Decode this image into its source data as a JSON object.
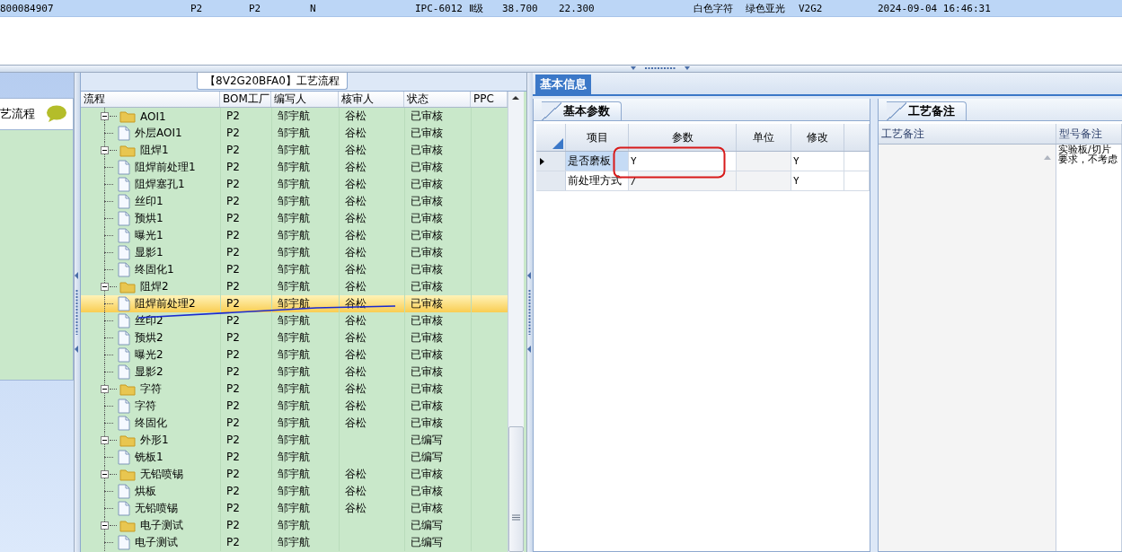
{
  "record_row": {
    "cells": [
      "800084907",
      "P2",
      "P2",
      "N",
      "IPC-6012 Ⅱ级",
      "38.700",
      "22.300",
      "白色字符",
      "绿色亚光",
      "V2G2",
      "2024-09-04 16:46:31"
    ]
  },
  "left_panel": {
    "title": "艺流程"
  },
  "flow": {
    "title": "【8V2G20BFA0】工艺流程",
    "columns": [
      "流程",
      "BOM工厂",
      "编写人",
      "核审人",
      "状态",
      "PPC"
    ],
    "tree": [
      {
        "name": "AOI1",
        "bom": "P2",
        "writer": "邹宇航",
        "reviewer": "谷松",
        "status": "已审核",
        "expanded": true,
        "selected": false,
        "children": [
          {
            "name": "外层AOI1",
            "bom": "P2",
            "writer": "邹宇航",
            "reviewer": "谷松",
            "status": "已审核",
            "selected": false
          }
        ]
      },
      {
        "name": "阻焊1",
        "bom": "P2",
        "writer": "邹宇航",
        "reviewer": "谷松",
        "status": "已审核",
        "expanded": true,
        "selected": false,
        "children": [
          {
            "name": "阻焊前处理1",
            "bom": "P2",
            "writer": "邹宇航",
            "reviewer": "谷松",
            "status": "已审核",
            "selected": false
          },
          {
            "name": "阻焊塞孔1",
            "bom": "P2",
            "writer": "邹宇航",
            "reviewer": "谷松",
            "status": "已审核",
            "selected": false
          },
          {
            "name": "丝印1",
            "bom": "P2",
            "writer": "邹宇航",
            "reviewer": "谷松",
            "status": "已审核",
            "selected": false
          },
          {
            "name": "预烘1",
            "bom": "P2",
            "writer": "邹宇航",
            "reviewer": "谷松",
            "status": "已审核",
            "selected": false
          },
          {
            "name": "曝光1",
            "bom": "P2",
            "writer": "邹宇航",
            "reviewer": "谷松",
            "status": "已审核",
            "selected": false
          },
          {
            "name": "显影1",
            "bom": "P2",
            "writer": "邹宇航",
            "reviewer": "谷松",
            "status": "已审核",
            "selected": false
          },
          {
            "name": "终固化1",
            "bom": "P2",
            "writer": "邹宇航",
            "reviewer": "谷松",
            "status": "已审核",
            "selected": false
          }
        ]
      },
      {
        "name": "阻焊2",
        "bom": "P2",
        "writer": "邹宇航",
        "reviewer": "谷松",
        "status": "已审核",
        "expanded": true,
        "selected": false,
        "children": [
          {
            "name": "阻焊前处理2",
            "bom": "P2",
            "writer": "邹宇航",
            "reviewer": "谷松",
            "status": "已审核",
            "selected": true
          },
          {
            "name": "丝印2",
            "bom": "P2",
            "writer": "邹宇航",
            "reviewer": "谷松",
            "status": "已审核",
            "selected": false
          },
          {
            "name": "预烘2",
            "bom": "P2",
            "writer": "邹宇航",
            "reviewer": "谷松",
            "status": "已审核",
            "selected": false
          },
          {
            "name": "曝光2",
            "bom": "P2",
            "writer": "邹宇航",
            "reviewer": "谷松",
            "status": "已审核",
            "selected": false
          },
          {
            "name": "显影2",
            "bom": "P2",
            "writer": "邹宇航",
            "reviewer": "谷松",
            "status": "已审核",
            "selected": false
          }
        ]
      },
      {
        "name": "字符",
        "bom": "P2",
        "writer": "邹宇航",
        "reviewer": "谷松",
        "status": "已审核",
        "expanded": true,
        "selected": false,
        "children": [
          {
            "name": "字符",
            "bom": "P2",
            "writer": "邹宇航",
            "reviewer": "谷松",
            "status": "已审核",
            "selected": false
          },
          {
            "name": "终固化",
            "bom": "P2",
            "writer": "邹宇航",
            "reviewer": "谷松",
            "status": "已审核",
            "selected": false
          }
        ]
      },
      {
        "name": "外形1",
        "bom": "P2",
        "writer": "邹宇航",
        "status": "已编写",
        "expanded": true,
        "selected": false,
        "children": [
          {
            "name": "铣板1",
            "bom": "P2",
            "writer": "邹宇航",
            "status": "已编写",
            "selected": false
          }
        ]
      },
      {
        "name": "无铅喷锡",
        "bom": "P2",
        "writer": "邹宇航",
        "reviewer": "谷松",
        "status": "已审核",
        "expanded": true,
        "selected": false,
        "children": [
          {
            "name": "烘板",
            "bom": "P2",
            "writer": "邹宇航",
            "reviewer": "谷松",
            "status": "已审核",
            "selected": false
          },
          {
            "name": "无铅喷锡",
            "bom": "P2",
            "writer": "邹宇航",
            "reviewer": "谷松",
            "status": "已审核",
            "selected": false
          }
        ]
      },
      {
        "name": "电子测试",
        "bom": "P2",
        "writer": "邹宇航",
        "status": "已编写",
        "expanded": true,
        "selected": false,
        "children": [
          {
            "name": "电子测试",
            "bom": "P2",
            "writer": "邹宇航",
            "status": "已编写",
            "selected": false
          }
        ]
      }
    ]
  },
  "info": {
    "tab": "基本信息",
    "params": {
      "tab": "基本参数",
      "columns": [
        "项目",
        "参数",
        "单位",
        "修改"
      ],
      "rows": [
        {
          "item": "是否磨板",
          "param": "Y",
          "modified": "Y",
          "current": true
        },
        {
          "item": "前处理方式",
          "param": "/",
          "modified": "Y",
          "current": false
        }
      ]
    },
    "notes": {
      "tab": "工艺备注",
      "columns": [
        "工艺备注",
        "型号备注"
      ],
      "model_note": [
        "实验板/切片",
        "要求，不考虑"
      ]
    }
  },
  "annotations": [
    {
      "kind": "line"
    },
    {
      "kind": "ring"
    }
  ]
}
